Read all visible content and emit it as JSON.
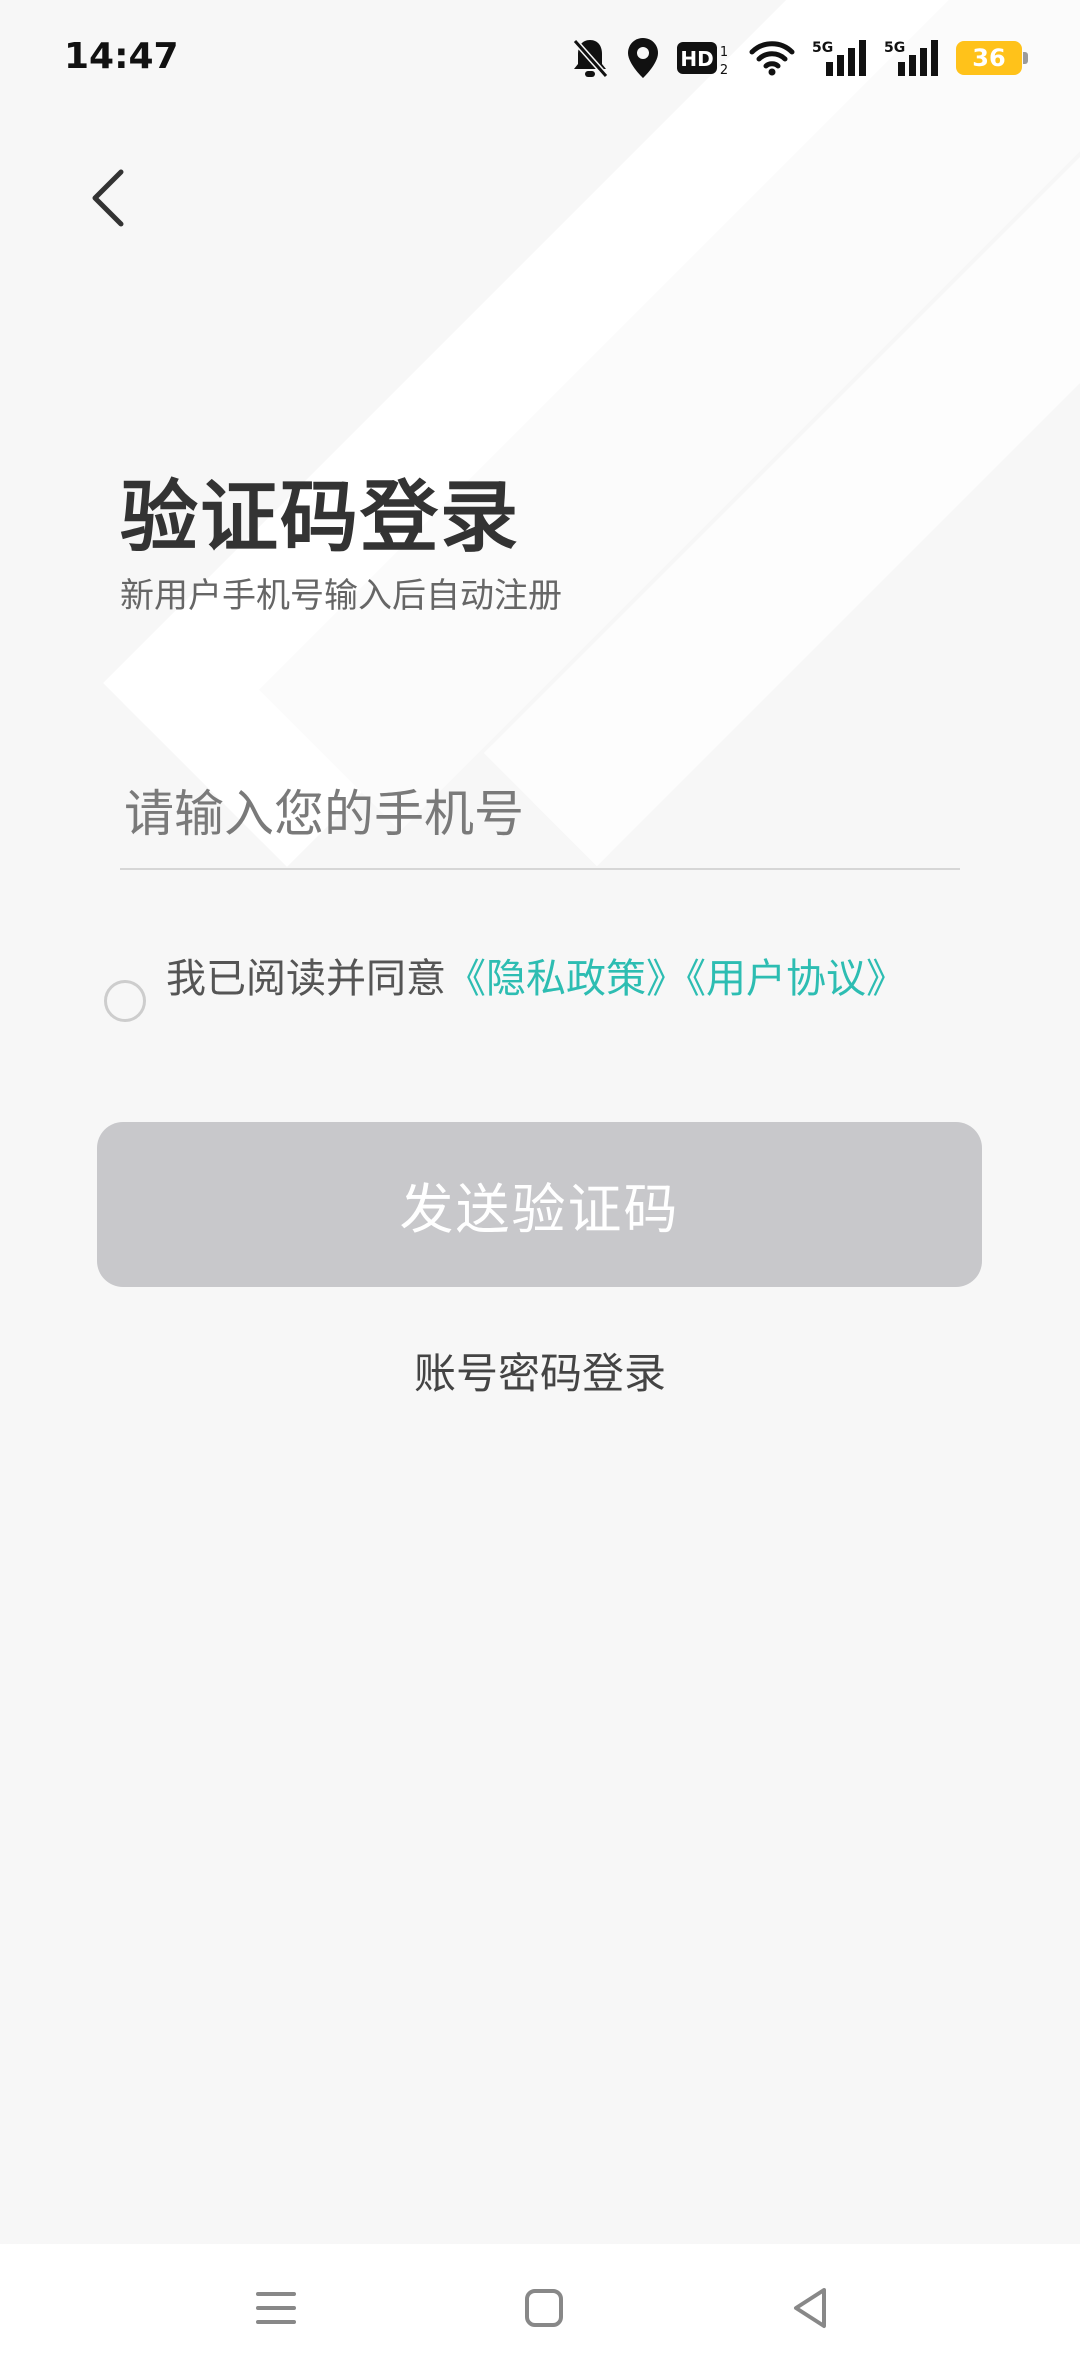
{
  "status_bar": {
    "time": "14:47",
    "battery_level": "36",
    "signal_1_label": "5G",
    "signal_2_label": "5G",
    "hd_label": "HD",
    "battery_color": "#ffc21a"
  },
  "header": {
    "back_icon": "chevron-left-icon"
  },
  "login": {
    "title": "验证码登录",
    "subtitle": "新用户手机号输入后自动注册",
    "phone_placeholder": "请输入您的手机号",
    "phone_value": "",
    "agreement_prefix": "我已阅读并同意",
    "privacy_link": "《隐私政策》",
    "user_agreement_link": "《用户协议》",
    "agreement_checked": false,
    "send_code_label": "发送验证码",
    "password_login_label": "账号密码登录"
  },
  "colors": {
    "link": "#2dbdb2",
    "button_disabled": "#c8c8cb",
    "background": "#f7f7f7"
  },
  "nav_bar": {
    "menu_icon": "menu-icon",
    "home_icon": "home-square-icon",
    "back_icon": "back-triangle-icon"
  }
}
